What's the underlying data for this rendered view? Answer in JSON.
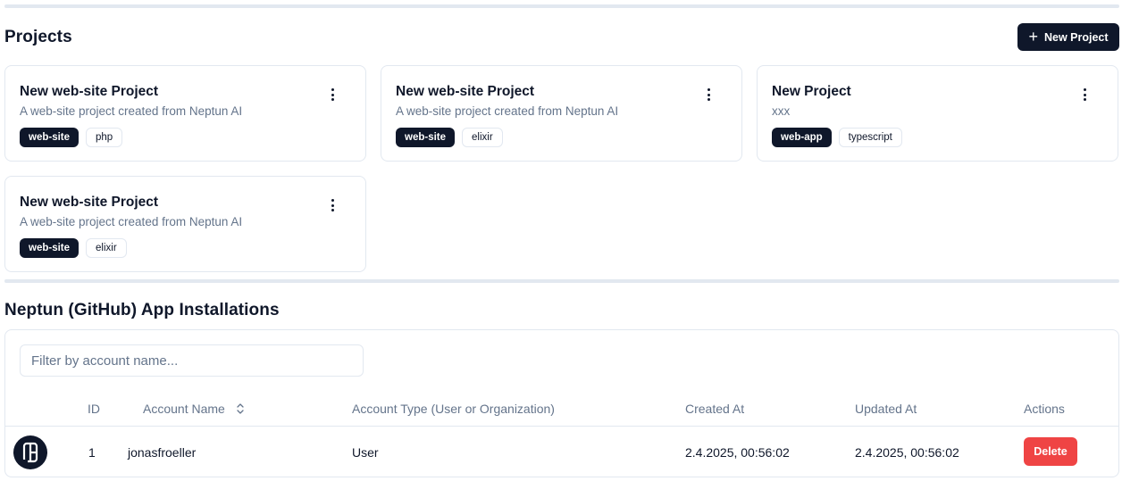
{
  "projects": {
    "title": "Projects",
    "new_button_label": "New Project",
    "new_button_icon": "plus-icon",
    "items": [
      {
        "title": "New web-site Project",
        "description": "A web-site project created from Neptun AI",
        "tags": [
          "web-site",
          "php"
        ]
      },
      {
        "title": "New web-site Project",
        "description": "A web-site project created from Neptun AI",
        "tags": [
          "web-site",
          "elixir"
        ]
      },
      {
        "title": "New Project",
        "description": "xxx",
        "tags": [
          "web-app",
          "typescript"
        ]
      },
      {
        "title": "New web-site Project",
        "description": "A web-site project created from Neptun AI",
        "tags": [
          "web-site",
          "elixir"
        ]
      }
    ]
  },
  "installations": {
    "title": "Neptun (GitHub) App Installations",
    "filter_placeholder": "Filter by account name...",
    "filter_value": "",
    "columns": [
      "ID",
      "Account Name",
      "Account Type (User or Organization)",
      "Created At",
      "Updated At",
      "Actions"
    ],
    "rows": [
      {
        "id": "1",
        "account_name": "jonasfroeller",
        "account_type": "User",
        "created_at": "2.4.2025, 00:56:02",
        "updated_at": "2.4.2025, 00:56:02",
        "action_label": "Delete"
      }
    ]
  },
  "colors": {
    "primary": "#0f172a",
    "danger": "#ef4444",
    "border": "#e2e8f0",
    "muted": "#64748b"
  }
}
